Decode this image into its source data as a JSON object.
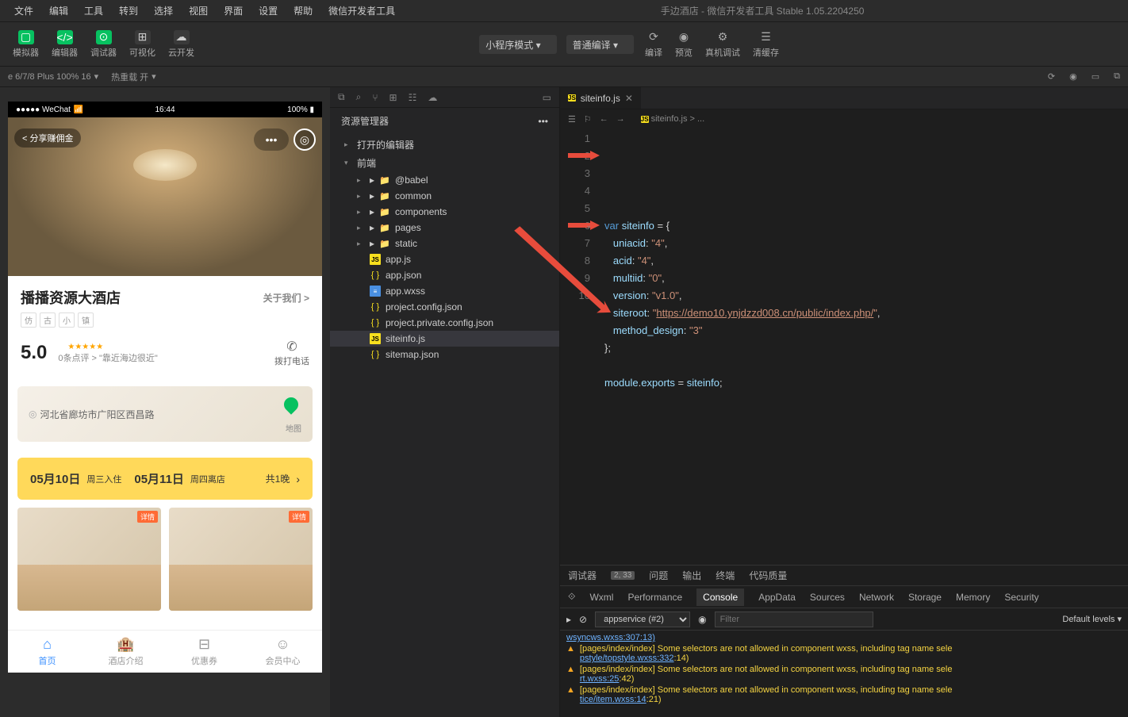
{
  "menubar": {
    "items": [
      "文件",
      "编辑",
      "工具",
      "转到",
      "选择",
      "视图",
      "界面",
      "设置",
      "帮助",
      "微信开发者工具"
    ],
    "title": "手边酒店 - 微信开发者工具 Stable 1.05.2204250"
  },
  "toolbar": {
    "simulator": "模拟器",
    "editor": "编辑器",
    "debugger": "调试器",
    "visual": "可视化",
    "cloud": "云开发",
    "mode_select": "小程序模式",
    "compile_select": "普通编译",
    "compile": "编译",
    "preview": "预览",
    "real_debug": "真机调试",
    "clear_cache": "清缓存"
  },
  "subbar": {
    "device": "e 6/7/8 Plus 100% 16",
    "hotreload": "热重载 开"
  },
  "phone": {
    "carrier": "●●●●● WeChat",
    "signal": "⚡",
    "time": "16:44",
    "battery": "100%",
    "share_label": "分享赚佣金",
    "hotel_name": "播播资源大酒店",
    "about": "关于我们",
    "tags": [
      "仿",
      "古",
      "小",
      "镇"
    ],
    "rating": "5.0",
    "stars": "★★★★★",
    "review_text": "0条点评 > \"靠近海边很近\"",
    "call_label": "拨打电话",
    "address": "河北省廊坊市广阳区西昌路",
    "map_label": "地图",
    "date1": "05月10日",
    "date1_label": "周三入住",
    "date2": "05月11日",
    "date2_label": "周四离店",
    "nights": "共1晚",
    "room_badge": "详情",
    "tabs": [
      "首页",
      "酒店介绍",
      "优惠券",
      "会员中心"
    ]
  },
  "explorer": {
    "title": "资源管理器",
    "open_editors": "打开的编辑器",
    "root": "前端",
    "items": [
      {
        "label": "@babel",
        "type": "folder",
        "pad": "pad2"
      },
      {
        "label": "common",
        "type": "folder",
        "pad": "pad2"
      },
      {
        "label": "components",
        "type": "folder",
        "pad": "pad2"
      },
      {
        "label": "pages",
        "type": "folder",
        "pad": "pad2"
      },
      {
        "label": "static",
        "type": "folder",
        "pad": "pad2"
      },
      {
        "label": "app.js",
        "type": "js",
        "pad": "pad2"
      },
      {
        "label": "app.json",
        "type": "json",
        "pad": "pad2"
      },
      {
        "label": "app.wxss",
        "type": "wxss",
        "pad": "pad2"
      },
      {
        "label": "project.config.json",
        "type": "json",
        "pad": "pad2"
      },
      {
        "label": "project.private.config.json",
        "type": "json",
        "pad": "pad2"
      },
      {
        "label": "siteinfo.js",
        "type": "js",
        "pad": "pad2",
        "selected": true
      },
      {
        "label": "sitemap.json",
        "type": "json",
        "pad": "pad2"
      }
    ]
  },
  "editor": {
    "tab_name": "siteinfo.js",
    "breadcrumb": "siteinfo.js > ...",
    "lines": [
      {
        "n": "1",
        "html": "<span class='kw'>var</span> <span class='prop'>siteinfo</span> <span class='punct'>= {</span>"
      },
      {
        "n": "2",
        "html": "   <span class='prop'>uniacid</span><span class='punct'>:</span> <span class='str'>\"4\"</span><span class='punct'>,</span>"
      },
      {
        "n": "3",
        "html": "   <span class='prop'>acid</span><span class='punct'>:</span> <span class='str'>\"4\"</span><span class='punct'>,</span>"
      },
      {
        "n": "4",
        "html": "   <span class='prop'>multiid</span><span class='punct'>:</span> <span class='str'>\"0\"</span><span class='punct'>,</span>"
      },
      {
        "n": "5",
        "html": "   <span class='prop'>version</span><span class='punct'>:</span> <span class='str'>\"v1.0\"</span><span class='punct'>,</span>"
      },
      {
        "n": "6",
        "html": "   <span class='prop'>siteroot</span><span class='punct'>:</span> <span class='str'>\"</span><span class='url'>https://demo10.ynjdzzd008.cn/public/index.php/</span><span class='str'>\"</span><span class='punct'>,</span>"
      },
      {
        "n": "7",
        "html": "   <span class='prop'>method_design</span><span class='punct'>:</span> <span class='str'>\"3\"</span>"
      },
      {
        "n": "8",
        "html": "<span class='punct'>};</span>"
      },
      {
        "n": "9",
        "html": ""
      },
      {
        "n": "10",
        "html": "<span class='prop'>module</span><span class='punct'>.</span><span class='prop'>exports</span> <span class='punct'>=</span> <span class='prop'>siteinfo</span><span class='punct'>;</span>"
      }
    ]
  },
  "devtools": {
    "tabs1": [
      {
        "label": "调试器"
      },
      {
        "label": "2, 33",
        "badge": true
      },
      {
        "label": "问题"
      },
      {
        "label": "输出"
      },
      {
        "label": "终端"
      },
      {
        "label": "代码质量"
      }
    ],
    "tabs2": [
      "Wxml",
      "Performance",
      "Console",
      "AppData",
      "Sources",
      "Network",
      "Storage",
      "Memory",
      "Security"
    ],
    "context_select": "appservice (#2)",
    "filter_placeholder": "Filter",
    "levels": "Default levels ▾",
    "warnings": [
      {
        "pre": "wsyncws.wxss:307:13)",
        "text": ""
      },
      {
        "text": "[pages/index/index] Some selectors are not allowed in component wxss, including tag name sele",
        "link": "pstyle/topstyle.wxss:332",
        "tail": ":14)"
      },
      {
        "text": "[pages/index/index] Some selectors are not allowed in component wxss, including tag name sele",
        "link": "rt.wxss:25",
        "tail": ":42)"
      },
      {
        "text": "[pages/index/index] Some selectors are not allowed in component wxss, including tag name sele",
        "link": "tice/item.wxss:14",
        "tail": ":21)"
      }
    ]
  }
}
